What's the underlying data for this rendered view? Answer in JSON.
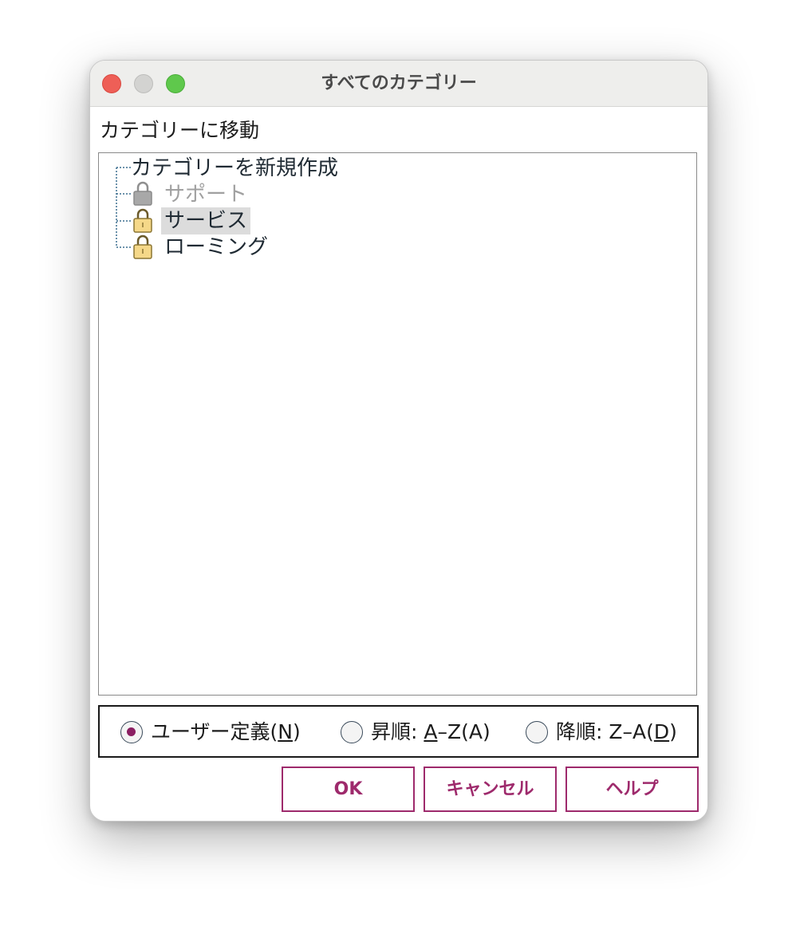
{
  "window": {
    "title": "すべてのカテゴリー",
    "controls": {
      "close": "close-button",
      "minimize": "minimize-button",
      "maximize": "maximize-button"
    }
  },
  "move_label": "カテゴリーに移動",
  "tree": {
    "items": [
      {
        "label": "カテゴリーを新規作成",
        "icon": "none",
        "state": "normal"
      },
      {
        "label": "サポート",
        "icon": "lock-icon",
        "state": "disabled"
      },
      {
        "label": "サービス",
        "icon": "lock-icon",
        "state": "selected"
      },
      {
        "label": "ローミング",
        "icon": "lock-icon",
        "state": "normal"
      }
    ]
  },
  "sort": {
    "options": [
      {
        "label_prefix": "ユーザー定義(",
        "mnemonic": "N",
        "label_suffix": ")",
        "checked": true
      },
      {
        "label_prefix": "昇順: ",
        "mnemonic": "A",
        "label_suffix": "–Z(A)",
        "checked": false
      },
      {
        "label_prefix": "降順: Z–A(",
        "mnemonic": "D",
        "label_suffix": ")",
        "checked": false
      }
    ]
  },
  "buttons": {
    "ok": "OK",
    "cancel": "キャンセル",
    "help": "ヘルプ"
  },
  "colors": {
    "accent": "#9e2a6c",
    "radio_dot": "#8b1f62",
    "lock_fill": "#f5d889",
    "lock_disabled": "#a8a8a8",
    "tree_line": "#3c6e8f"
  }
}
